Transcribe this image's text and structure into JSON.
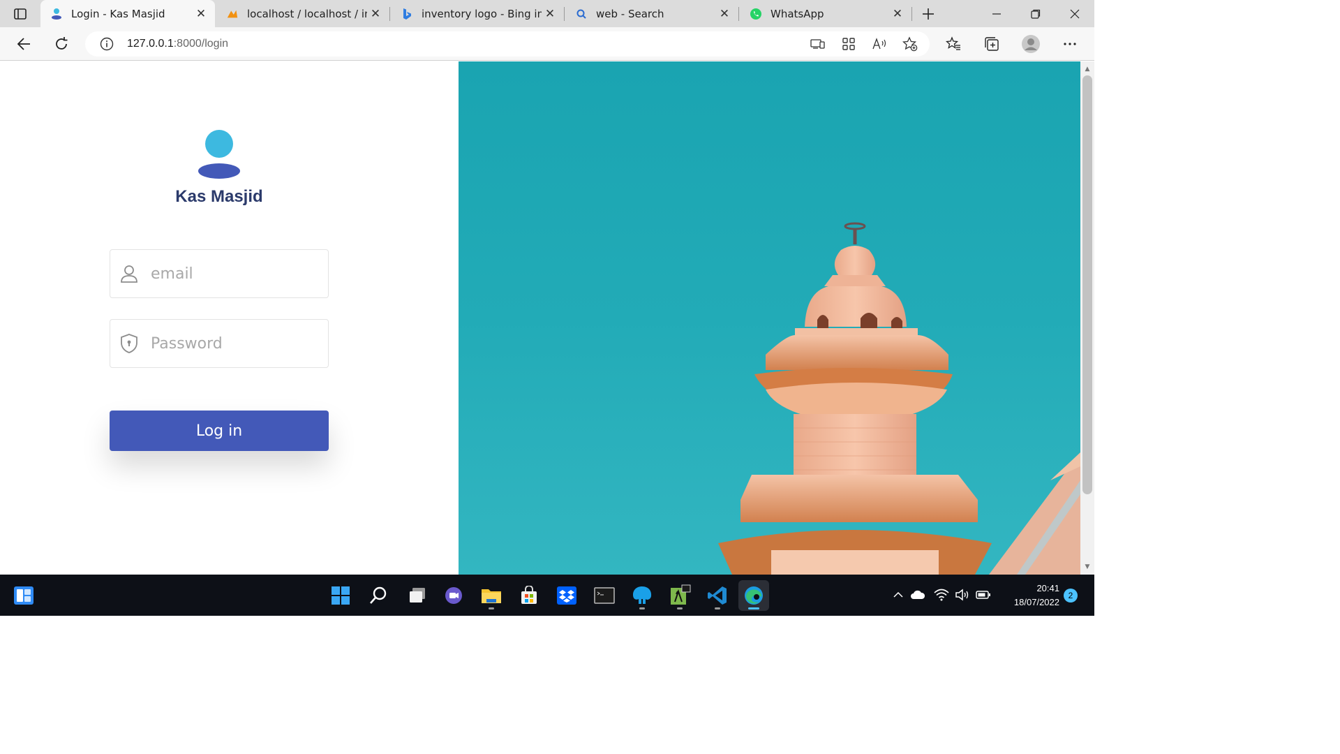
{
  "browser": {
    "tabs": [
      {
        "title": "Login - Kas Masjid",
        "icon": "user-favicon",
        "active": true
      },
      {
        "title": "localhost / localhost / inve",
        "icon": "phpmyadmin-favicon",
        "active": false
      },
      {
        "title": "inventory logo - Bing imag",
        "icon": "bing-favicon",
        "active": false
      },
      {
        "title": "web - Search",
        "icon": "search-favicon",
        "active": false
      },
      {
        "title": "WhatsApp",
        "icon": "whatsapp-favicon",
        "active": false
      }
    ],
    "close_glyph": "✕",
    "address": {
      "host": "127.0.0.1",
      "path": ":8000/login"
    }
  },
  "page": {
    "brand": "Kas Masjid",
    "email_placeholder": "email",
    "password_placeholder": "Password",
    "login_label": "Log in",
    "colors": {
      "primary": "#4359b8",
      "avatar_head": "#3db9e0",
      "sky": "#1aa4b1"
    }
  },
  "taskbar": {
    "time": "20:41",
    "date": "18/07/2022",
    "notifications": "2"
  }
}
